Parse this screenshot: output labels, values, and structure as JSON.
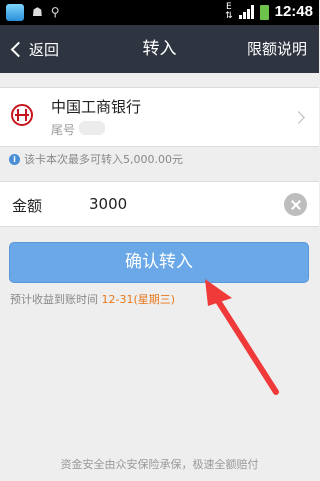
{
  "status_bar": {
    "network": "E",
    "time": "12:48"
  },
  "header": {
    "back_label": "返回",
    "title": "转入",
    "right_link": "限额说明"
  },
  "bank": {
    "name": "中国工商银行",
    "tail_label": "尾号"
  },
  "info": {
    "limit_note": "该卡本次最多可转入5,000.00元"
  },
  "amount": {
    "label": "金额",
    "value": "3000"
  },
  "confirm_label": "确认转入",
  "estimate": {
    "prefix": "预计收益到账时间",
    "date": "12-31(星期三)"
  },
  "footer": {
    "note": "资金安全由众安保险承保，极速全额赔付"
  },
  "colors": {
    "titlebar": "#2e3440",
    "confirm_button": "#6aa8e8",
    "estimate_date": "#e8771a",
    "bank_brand": "#c4161c",
    "arrow": "#f03a3a"
  }
}
